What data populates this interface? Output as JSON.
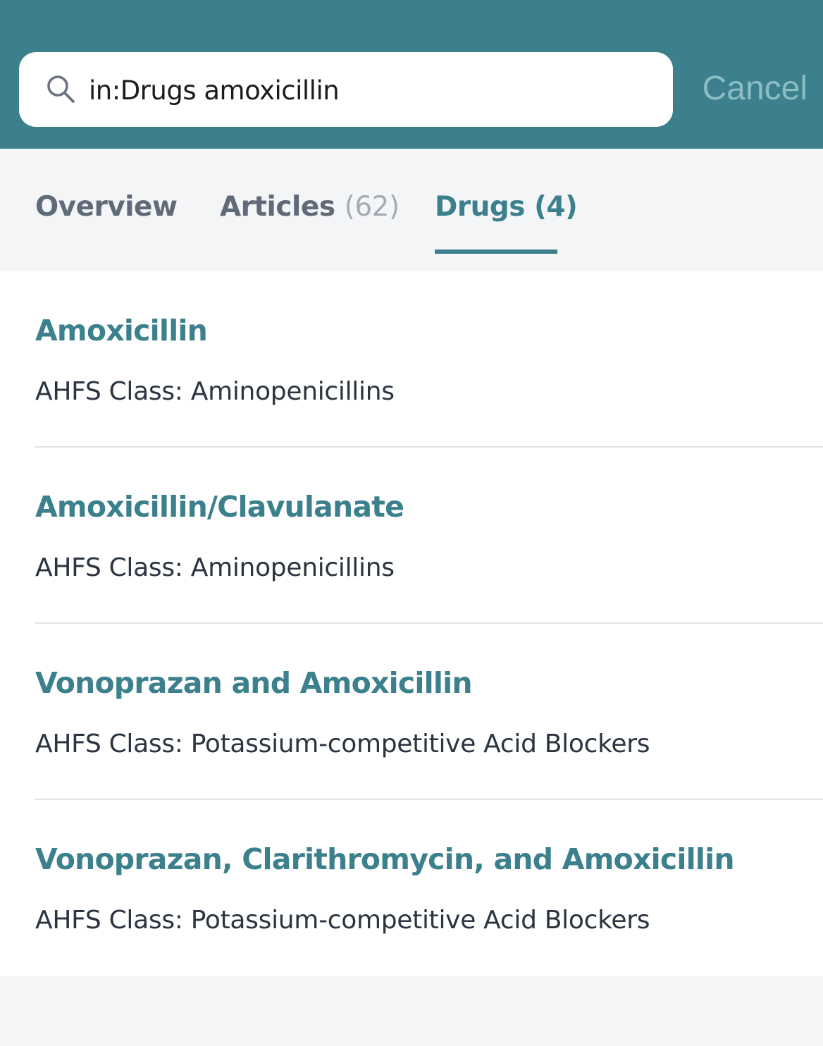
{
  "search": {
    "value": "in:Drugs amoxicillin",
    "cancel_label": "Cancel"
  },
  "tabs": [
    {
      "label": "Overview",
      "count": "",
      "active": false
    },
    {
      "label": "Articles",
      "count": "(62)",
      "active": false
    },
    {
      "label": "Drugs",
      "count": "(4)",
      "active": true
    }
  ],
  "results": [
    {
      "title": "Amoxicillin",
      "subtitle": "AHFS Class: Aminopenicillins"
    },
    {
      "title": "Amoxicillin/Clavulanate",
      "subtitle": "AHFS Class: Aminopenicillins"
    },
    {
      "title": "Vonoprazan and Amoxicillin",
      "subtitle": "AHFS Class: Potassium-competitive Acid Blockers"
    },
    {
      "title": "Vonoprazan, Clarithromycin, and Amoxicillin",
      "subtitle": "AHFS Class: Potassium-competitive Acid Blockers"
    }
  ],
  "colors": {
    "header_bg": "#3b808c",
    "accent": "#3b808c",
    "cancel": "#8dbdc4",
    "tab_inactive": "#5f6b78",
    "subtitle": "#2b3440"
  },
  "icons": {
    "search": "search-icon"
  }
}
